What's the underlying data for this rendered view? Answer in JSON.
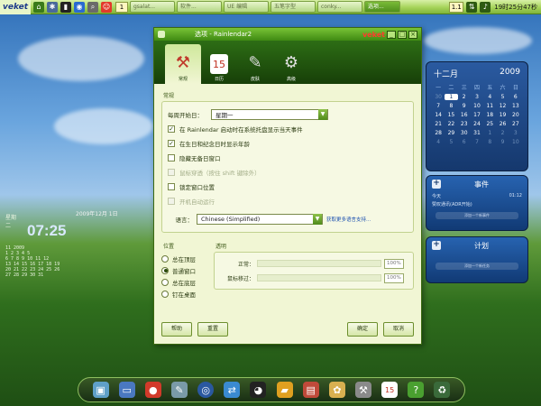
{
  "taskbar": {
    "logo": "veket",
    "workspace": "1",
    "tasks": [
      "gsalat...",
      "软件...",
      "UE 编辑",
      "五笔字型",
      "conky...",
      "选项..."
    ],
    "page_num": "1.1",
    "clock": "19时25分47秒"
  },
  "desktop": {
    "date_line": "2009年12月 1日",
    "time": "07:25",
    "weekday_label": "星期\n二",
    "left_lines": [
      "11 2009",
      "1  2  3  4  5",
      "6  7  8  9 10 11 12",
      "13 14 15 16 17 18 19",
      "20 21 22 23 24 25 26",
      "27 28 29 30 31"
    ]
  },
  "dialog": {
    "title": "选项 - Rainlendar2",
    "brand": "veket",
    "toolbar": [
      {
        "label": "常规",
        "icon": "tools-icon"
      },
      {
        "label": "日历",
        "icon": "calendar-icon"
      },
      {
        "label": "皮肤",
        "icon": "skin-icon"
      },
      {
        "label": "高级",
        "icon": "gear-icon"
      }
    ],
    "section_general": "常规",
    "week_start_label": "每周开始日：",
    "week_start_value": "星期一",
    "options": [
      {
        "label": "在 Rainlendar 启动时在系统托盘显示当天事件",
        "checked": true,
        "disabled": false
      },
      {
        "label": "在生日和纪念日时显示年龄",
        "checked": true,
        "disabled": false
      },
      {
        "label": "隐藏无备日窗口",
        "checked": false,
        "disabled": false
      },
      {
        "label": "鼠标穿透（按住 shift 键除外）",
        "checked": false,
        "disabled": true
      },
      {
        "label": "锁定窗口位置",
        "checked": false,
        "disabled": false
      },
      {
        "label": "开机自动运行",
        "checked": false,
        "disabled": true
      }
    ],
    "language_label": "语言：",
    "language_value": "Chinese (Simplified)",
    "language_link": "获取更多语言支持...",
    "position_label": "位置",
    "positions": [
      {
        "label": "总在顶层",
        "selected": false
      },
      {
        "label": "普通窗口",
        "selected": true
      },
      {
        "label": "总在底层",
        "selected": false
      },
      {
        "label": "钉在桌面",
        "selected": false
      }
    ],
    "transparency_label": "透明",
    "normal_label": "正常：",
    "normal_value": "100%",
    "hover_label": "鼠标移过：",
    "hover_value": "100%",
    "help_button": "帮助",
    "reset_button": "重置",
    "ok_button": "确定",
    "cancel_button": "取消"
  },
  "calendar": {
    "month": "十二月",
    "year": "2009",
    "weekdays": [
      "一",
      "二",
      "三",
      "四",
      "五",
      "六",
      "日"
    ],
    "days": [
      [
        "30",
        "1",
        "2",
        "3",
        "4",
        "5",
        "6"
      ],
      [
        "7",
        "8",
        "9",
        "10",
        "11",
        "12",
        "13"
      ],
      [
        "14",
        "15",
        "16",
        "17",
        "18",
        "19",
        "20"
      ],
      [
        "21",
        "22",
        "23",
        "24",
        "25",
        "26",
        "27"
      ],
      [
        "28",
        "29",
        "30",
        "31",
        "1",
        "2",
        "3"
      ],
      [
        "4",
        "5",
        "6",
        "7",
        "8",
        "9",
        "10"
      ]
    ]
  },
  "events": {
    "title": "事件",
    "row1_left": "今天",
    "row1_right": "01:12",
    "row2_left": "赞叹通讯(ADR开始)",
    "add_label": "添加一个新事件"
  },
  "plan": {
    "title": "计划",
    "add_label": "添加一个新任务"
  }
}
